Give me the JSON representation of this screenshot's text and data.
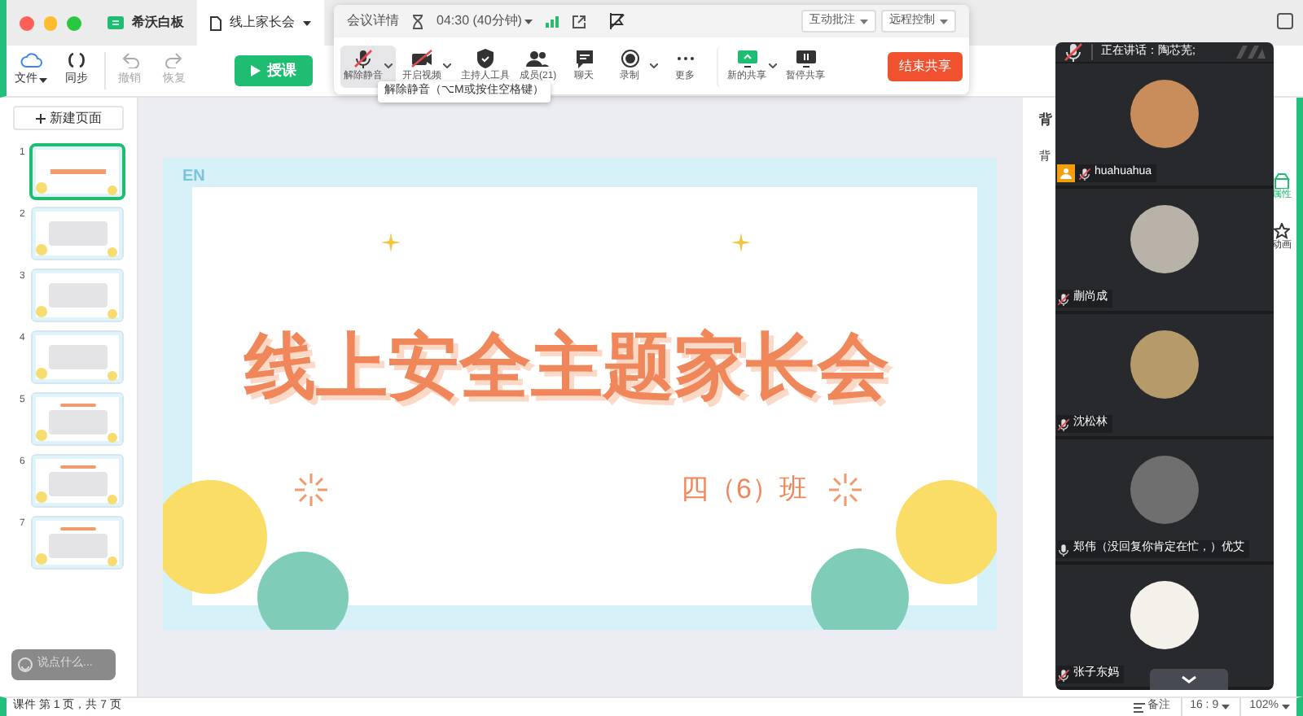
{
  "window_tabs": [
    {
      "label": "希沃白板",
      "kind": "app",
      "selected": false
    },
    {
      "label": "线上家长会",
      "kind": "document",
      "selected": true
    }
  ],
  "toolbar": [
    {
      "label": "文件",
      "disabled": false
    },
    {
      "label": "同步",
      "disabled": false
    },
    {
      "label": "撤销",
      "disabled": true
    },
    {
      "label": "恢复",
      "disabled": true
    }
  ],
  "teach_button": "授课",
  "meeting_bar": {
    "details": "会议详情",
    "timer": "04:30 (40分钟)",
    "buttons": [
      "互动批注",
      "远程控制"
    ],
    "tools": [
      {
        "label": "解除静音",
        "dropdown": true,
        "selected": true
      },
      {
        "label": "开启视频",
        "dropdown": true,
        "selected": false
      },
      {
        "label": "主持人工具",
        "dropdown": false,
        "selected": false
      },
      {
        "label": "成员(21)",
        "dropdown": false,
        "selected": false
      },
      {
        "label": "聊天",
        "dropdown": false,
        "selected": false
      },
      {
        "label": "录制",
        "dropdown": true,
        "selected": false
      },
      {
        "label": "更多",
        "dropdown": false,
        "selected": false
      },
      {
        "label": "新的共享",
        "dropdown": true,
        "selected": false
      },
      {
        "label": "暂停共享",
        "dropdown": false,
        "selected": false
      }
    ],
    "end_button": "结束共享",
    "tooltip": "解除静音（⌥M或按住空格键）"
  },
  "sidebar": {
    "new_page": "新建页面",
    "pages": [
      {
        "number": "1",
        "selected": true
      },
      {
        "number": "2",
        "selected": false
      },
      {
        "number": "3",
        "selected": false
      },
      {
        "number": "4",
        "selected": false
      },
      {
        "number": "5",
        "selected": false
      },
      {
        "number": "6",
        "selected": false
      },
      {
        "number": "7",
        "selected": false
      }
    ],
    "chat_placeholder": "说点什么..."
  },
  "slide": {
    "watermark": "EN",
    "title": "线上安全主题家长会",
    "subtitle": "四（6）班"
  },
  "right_panel": {
    "heading": "背",
    "label": "背",
    "tabs": [
      {
        "label": "属性",
        "selected": true
      },
      {
        "label": "动画",
        "selected": false
      }
    ]
  },
  "video_panel": {
    "speaking": "正在讲话：陶芯芜;",
    "participants": [
      {
        "name": "huahuahua",
        "host": true,
        "muted": true
      },
      {
        "name": "蒯尚成",
        "host": false,
        "muted": true
      },
      {
        "name": "沈松林",
        "host": false,
        "muted": true
      },
      {
        "name": "郑伟（没回复你肯定在忙，）优艾",
        "host": false,
        "muted": false
      },
      {
        "name": "张子东妈",
        "host": false,
        "muted": true
      }
    ]
  },
  "status_bar": {
    "page_info": "课件 第 1 页，共 7 页",
    "notes": "备注",
    "ratio": "16 : 9",
    "zoom": "102%"
  }
}
